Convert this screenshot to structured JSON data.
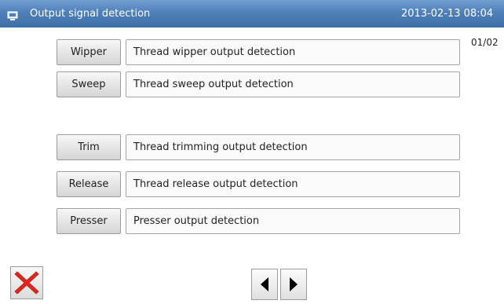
{
  "header": {
    "title": "Output signal detection",
    "datetime": "2013-02-13 08:04",
    "icon": "monitor-icon"
  },
  "page_indicator": "01/02",
  "rows": [
    {
      "button_label": "Wipper",
      "description": "Thread wipper output detection"
    },
    {
      "button_label": "Sweep",
      "description": "Thread sweep output detection"
    },
    {
      "button_label": "Trim",
      "description": "Thread trimming output detection"
    },
    {
      "button_label": "Release",
      "description": "Thread release output detection"
    },
    {
      "button_label": "Presser",
      "description": "Presser output detection"
    }
  ],
  "footer": {
    "close_icon": "close-icon",
    "prev_icon": "arrow-left-icon",
    "next_icon": "arrow-right-icon",
    "close_color": "#e0261e"
  },
  "colors": {
    "titlebar": "#4f80b8",
    "background": "#ffffff"
  }
}
